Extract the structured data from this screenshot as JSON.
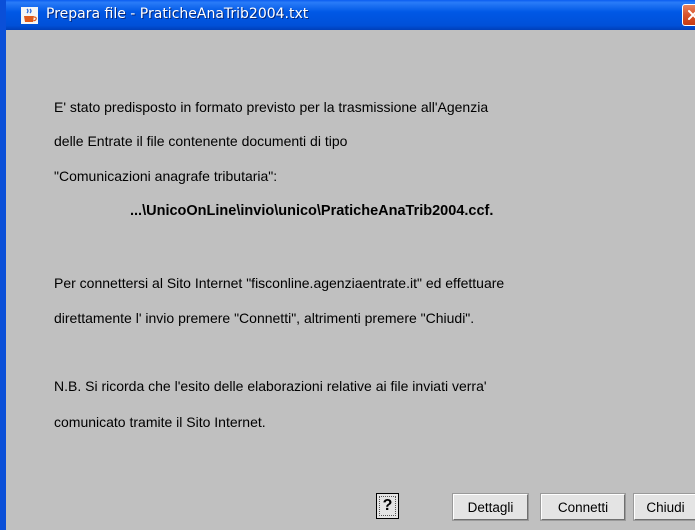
{
  "window": {
    "title": "Prepara file - PraticheAnaTrib2004.txt"
  },
  "message": {
    "line1": "E' stato predisposto in formato previsto per la trasmissione all'Agenzia",
    "line2": "delle Entrate il file contenente documenti di tipo",
    "line3": "\"Comunicazioni anagrafe tributaria\":",
    "file_path": "...\\UnicoOnLine\\invio\\unico\\PraticheAnaTrib2004.ccf.",
    "line5": "Per connettersi al Sito Internet \"fisconline.agenziaentrate.it\" ed effettuare",
    "line6": "direttamente l' invio premere  \"Connetti\", altrimenti premere  \"Chiudi\".",
    "line7": "N.B.  Si ricorda che l'esito delle elaborazioni relative ai file inviati verra'",
    "line8": "comunicato tramite  il  Sito Internet."
  },
  "buttons": {
    "help": "?",
    "details": "Dettagli",
    "connect": "Connetti",
    "close": "Chiudi"
  },
  "icons": {
    "app": "java-coffee-icon",
    "close": "close-icon"
  },
  "colors": {
    "titlebar": "#0058e6",
    "background": "#c0c0c0",
    "close_button": "#d9532a"
  }
}
